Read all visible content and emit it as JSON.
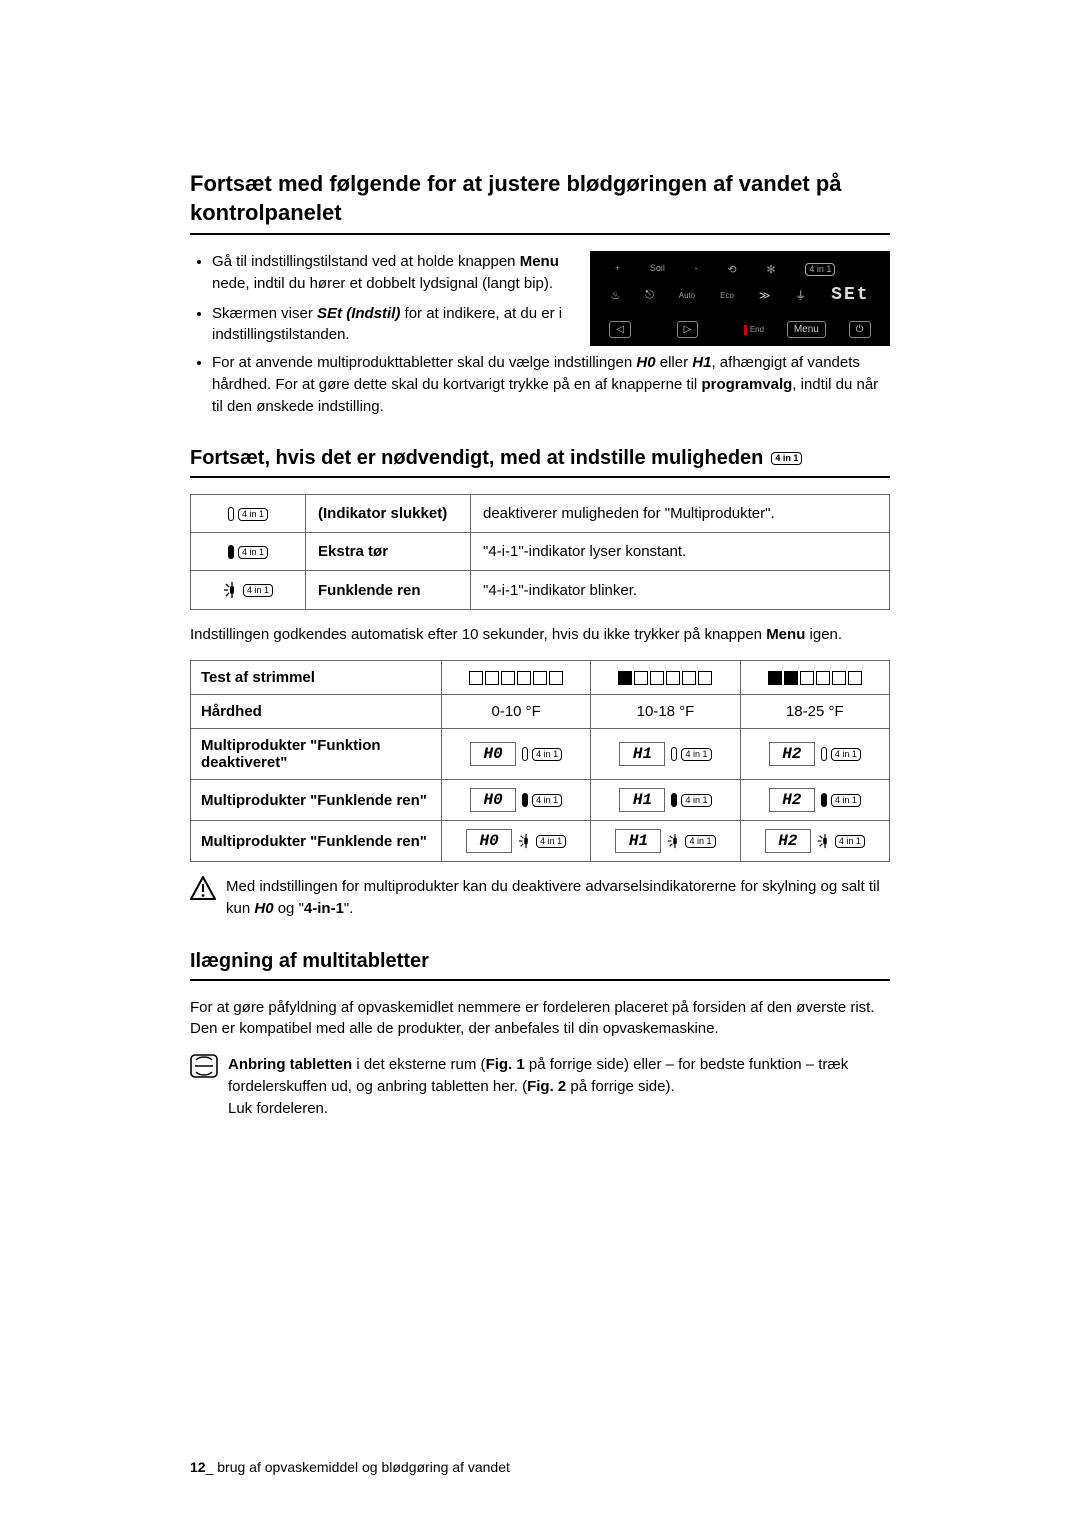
{
  "heading1": "Fortsæt med følgende for at justere blødgøringen af vandet på kontrolpanelet",
  "bullets1": [
    {
      "pre": "Gå til indstillingstilstand ved at holde knappen ",
      "b": "Menu",
      "post": " nede, indtil du hører et dobbelt lydsignal (langt bip)."
    },
    {
      "pre": "Skærmen viser ",
      "bi": "SEt (Indstil)",
      "post": " for at indikere, at du er i indstillingstilstanden."
    }
  ],
  "bullet_long": {
    "t1": "For at anvende multiprodukttabletter skal du vælge indstillingen ",
    "h0": "H0",
    "or": " eller ",
    "h1": "H1",
    "t2": ", afhængigt af vandets hårdhed. For at gøre dette skal du kortvarigt trykke på en af knapperne til ",
    "b": "programvalg",
    "t3": ", indtil du når til den ønskede indstilling."
  },
  "panel": {
    "soil": "Soil",
    "plus": "+",
    "minus": "-",
    "auto": "Auto",
    "eco": "Eco",
    "set": "SEt",
    "menu": "Menu",
    "end": "End",
    "fourin1": "4 in 1"
  },
  "heading2": "Fortsæt, hvis det er nødvendigt, med at indstille muligheden",
  "table1": [
    {
      "icon": "empty4in1",
      "label": "(Indikator slukket)",
      "desc": "deaktiverer muligheden for \"Multiprodukter\"."
    },
    {
      "icon": "solid4in1",
      "label": "Ekstra tør",
      "desc": "\"4-i-1\"-indikator lyser konstant."
    },
    {
      "icon": "sparkle4in1",
      "label": "Funklende ren",
      "desc": "\"4-i-1\"-indikator blinker."
    }
  ],
  "para_autosave": {
    "t1": "Indstillingen godkendes automatisk efter 10 sekunder, hvis du ikke trykker på knappen ",
    "b": "Menu",
    "t2": " igen."
  },
  "table2": {
    "h_strip": "Test af strimmel",
    "h_hard": "Hårdhed",
    "cols_hard": [
      "0-10 °F",
      "10-18 °F",
      "18-25 °F"
    ],
    "rows": [
      {
        "label": "Multiprodukter \"Funktion deaktiveret\"",
        "codes": [
          "H0",
          "H1",
          "H2"
        ],
        "style": "empty"
      },
      {
        "label": "Multiprodukter \"Funklende ren\"",
        "codes": [
          "H0",
          "H1",
          "H2"
        ],
        "style": "solid"
      },
      {
        "label": "Multiprodukter \"Funklende ren\"",
        "codes": [
          "H0",
          "H1",
          "H2"
        ],
        "style": "sparkle"
      }
    ],
    "strip_fill": [
      0,
      1,
      2
    ]
  },
  "warn": {
    "t1": "Med indstillingen for multiprodukter kan du deaktivere advarselsindikatorerne for skylning og salt til kun ",
    "h0": "H0",
    "og": " og \"",
    "b": "4-in-1",
    "t2": "\"."
  },
  "heading3": "Ilægning af multitabletter",
  "para3": "For at gøre påfyldning af opvaskemidlet nemmere er fordeleren placeret på forsiden af den øverste rist. Den er kompatibel med alle de produkter, der anbefales til din opvaskemaskine.",
  "tips": {
    "l1a": "Anbring tabletten",
    "l1b": " i det eksterne rum (",
    "f1": "Fig. 1",
    "l1c": " på forrige side) eller – for bedste funktion – træk fordelerskuffen ud, og anbring tabletten her. (",
    "f2": "Fig. 2",
    "l1d": " på forrige side).",
    "l2": "Luk fordeleren."
  },
  "footer": {
    "page": "12",
    "sep": "_ ",
    "section": "brug af opvaskemiddel og blødgøring af vandet"
  },
  "icons": {
    "fourin1": "4 in 1"
  },
  "chart_data": {
    "type": "table",
    "title": "Multiprodukt-indstilling vs. vandhårdhed",
    "columns": [
      "Test af strimmel (fyldte felter)",
      "Hårdhed",
      "Multiprodukter \"Funktion deaktiveret\"",
      "Multiprodukter \"Funklende ren\" (lyser)",
      "Multiprodukter \"Funklende ren\" (blinker)"
    ],
    "rows": [
      [
        0,
        "0-10 °F",
        "H0",
        "H0",
        "H0"
      ],
      [
        1,
        "10-18 °F",
        "H1",
        "H1",
        "H1"
      ],
      [
        2,
        "18-25 °F",
        "H2",
        "H2",
        "H2"
      ]
    ]
  }
}
